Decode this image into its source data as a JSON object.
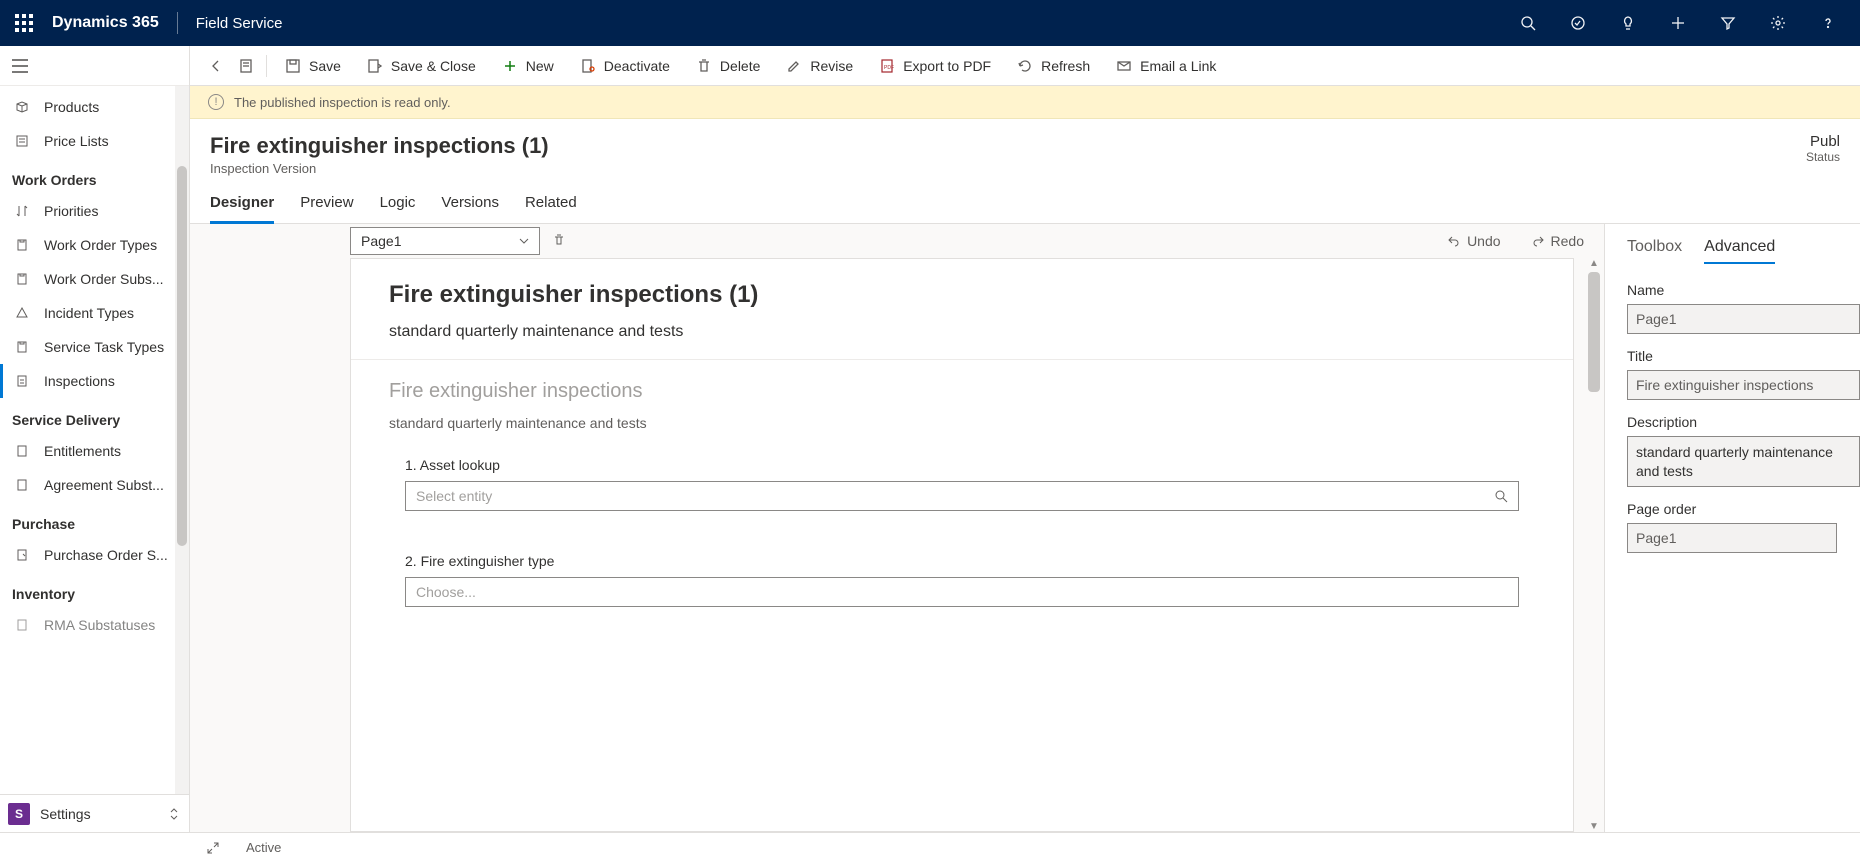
{
  "topbar": {
    "brand": "Dynamics 365",
    "appName": "Field Service"
  },
  "sidebar": {
    "top": [
      {
        "icon": "box",
        "label": "Products"
      },
      {
        "icon": "list",
        "label": "Price Lists"
      }
    ],
    "groups": [
      {
        "label": "Work Orders",
        "items": [
          {
            "icon": "arrows",
            "label": "Priorities"
          },
          {
            "icon": "clip",
            "label": "Work Order Types"
          },
          {
            "icon": "clip",
            "label": "Work Order Subs..."
          },
          {
            "icon": "warn",
            "label": "Incident Types"
          },
          {
            "icon": "clip",
            "label": "Service Task Types"
          },
          {
            "icon": "clip",
            "label": "Inspections",
            "active": true
          }
        ]
      },
      {
        "label": "Service Delivery",
        "items": [
          {
            "icon": "doc",
            "label": "Entitlements"
          },
          {
            "icon": "doc",
            "label": "Agreement Subst..."
          }
        ]
      },
      {
        "label": "Purchase",
        "items": [
          {
            "icon": "cart",
            "label": "Purchase Order S..."
          }
        ]
      },
      {
        "label": "Inventory",
        "items": [
          {
            "icon": "doc",
            "label": "RMA Substatuses"
          }
        ]
      }
    ],
    "settingsBadge": "S",
    "settings": "Settings"
  },
  "commands": {
    "save": "Save",
    "saveClose": "Save & Close",
    "new": "New",
    "deactivate": "Deactivate",
    "delete": "Delete",
    "revise": "Revise",
    "export": "Export to PDF",
    "refresh": "Refresh",
    "email": "Email a Link"
  },
  "banner": "The published inspection is read only.",
  "record": {
    "title": "Fire extinguisher inspections (1)",
    "subtitle": "Inspection Version",
    "state": "Publ",
    "stateLabel": "Status"
  },
  "tabs": [
    "Designer",
    "Preview",
    "Logic",
    "Versions",
    "Related"
  ],
  "designer": {
    "pageSelector": "Page1",
    "undo": "Undo",
    "redo": "Redo",
    "canvas": {
      "title": "Fire extinguisher inspections (1)",
      "desc": "standard quarterly maintenance and tests",
      "pageTitle": "Fire extinguisher inspections",
      "pageDesc": "standard quarterly maintenance and tests",
      "q1": {
        "label": "1. Asset lookup",
        "placeholder": "Select entity"
      },
      "q2": {
        "label": "2. Fire extinguisher type",
        "placeholder": "Choose..."
      }
    }
  },
  "props": {
    "tabs": [
      "Toolbox",
      "Advanced"
    ],
    "name": {
      "label": "Name",
      "value": "Page1"
    },
    "title": {
      "label": "Title",
      "value": "Fire extinguisher inspections"
    },
    "description": {
      "label": "Description",
      "value": "standard quarterly maintenance and tests"
    },
    "pageOrder": {
      "label": "Page order",
      "value": "Page1"
    }
  },
  "statusbar": {
    "active": "Active"
  }
}
